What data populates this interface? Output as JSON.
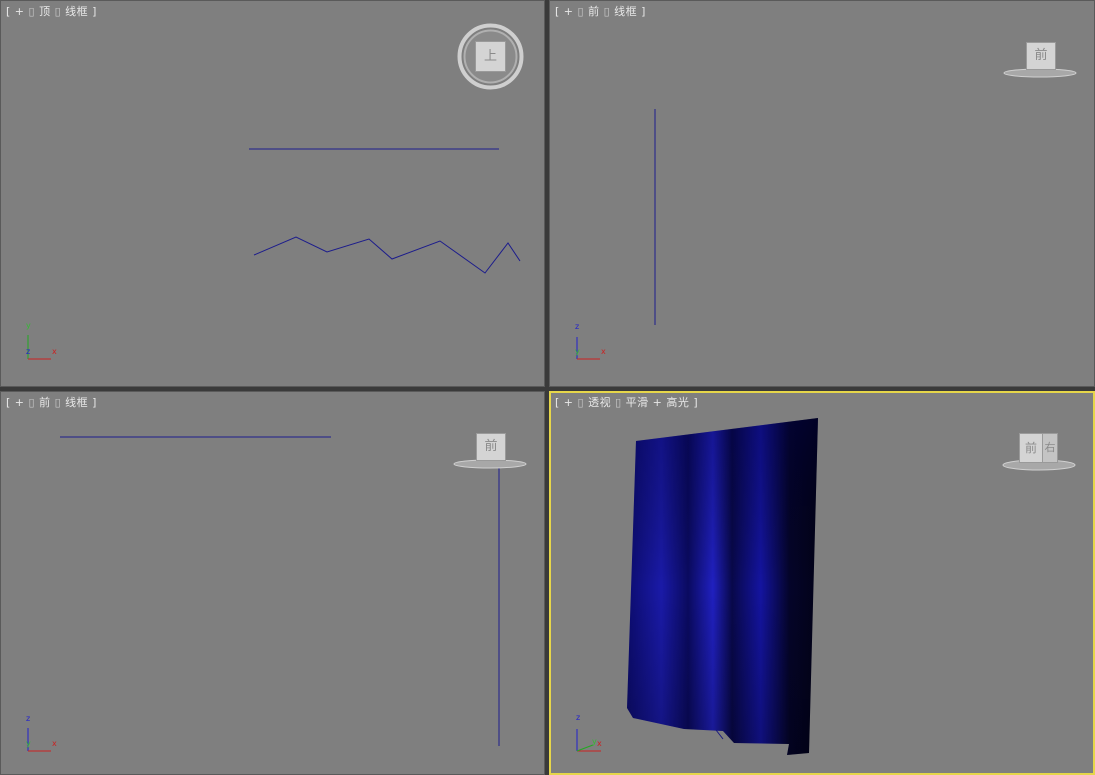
{
  "viewports": {
    "top": {
      "label": {
        "bracket_open": "[",
        "plus": "+",
        "sep1": "▯",
        "view": "顶",
        "sep2": "▯",
        "mode": "线框",
        "bracket_close": "]"
      },
      "viewcube_face": "上",
      "axes": {
        "vertical": "y",
        "depth": "z",
        "horizontal": "x"
      }
    },
    "front_tr": {
      "label": {
        "bracket_open": "[",
        "plus": "+",
        "sep1": "▯",
        "view": "前",
        "sep2": "▯",
        "mode": "线框",
        "bracket_close": "]"
      },
      "viewcube_face": "前",
      "axes": {
        "vertical": "z",
        "depth": "y",
        "horizontal": "x"
      }
    },
    "front_bl": {
      "label": {
        "bracket_open": "[",
        "plus": "+",
        "sep1": "▯",
        "view": "前",
        "sep2": "▯",
        "mode": "线框",
        "bracket_close": "]"
      },
      "viewcube_face": "前",
      "axes": {
        "vertical": "z",
        "depth": "y",
        "horizontal": "x"
      }
    },
    "perspective": {
      "label": {
        "bracket_open": "[",
        "plus": "+",
        "sep1": "▯",
        "view": "透视",
        "sep2": "▯",
        "mode": "平滑 + 高光",
        "bracket_close": "]"
      },
      "viewcube_face_front": "前",
      "viewcube_face_right": "右",
      "axes": {
        "vertical": "z",
        "depth": "y",
        "horizontal": "x"
      },
      "active": true
    }
  },
  "colors": {
    "viewport_bg": "#7f7f7f",
    "active_border": "#e6d64a",
    "spline": "#1c1c8c",
    "curtain": "#0a0a78",
    "axis_x": "#cc2222",
    "axis_y": "#22aa22",
    "axis_z": "#2222cc"
  }
}
